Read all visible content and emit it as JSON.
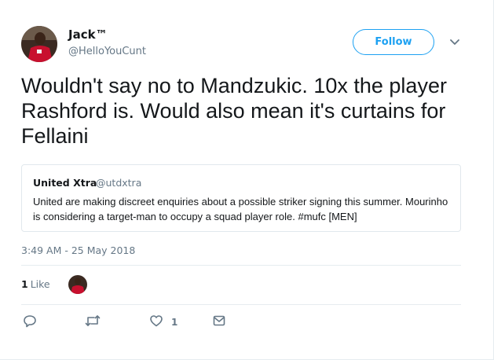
{
  "author": {
    "display_name": "Jack™",
    "handle": "@HelloYouCunt",
    "avatar_icon": "profile-photo-red-kit"
  },
  "follow_button": {
    "label": "Follow"
  },
  "menu_icon": "chevron-down-icon",
  "tweet": {
    "text": "Wouldn't say no to Mandzukic. 10x the player Rashford is. Would also mean it's curtains for Fellaini",
    "timestamp": "3:49 AM - 25 May 2018"
  },
  "quoted_tweet": {
    "display_name": "United Xtra",
    "handle": "@utdxtra",
    "text": "United are making discreet enquiries about a possible striker signing this summer. Mourinho is considering a target-man to occupy a squad player role. #mufc [MEN]"
  },
  "stats": {
    "likes_count": "1",
    "likes_label": "Like"
  },
  "actions": {
    "reply_icon": "reply-icon",
    "retweet_icon": "retweet-icon",
    "like_icon": "heart-icon",
    "like_count": "1",
    "dm_icon": "envelope-icon"
  },
  "colors": {
    "accent": "#1da1f2",
    "text_primary": "#14171a",
    "text_secondary": "#657786",
    "border": "#e1e8ed"
  }
}
